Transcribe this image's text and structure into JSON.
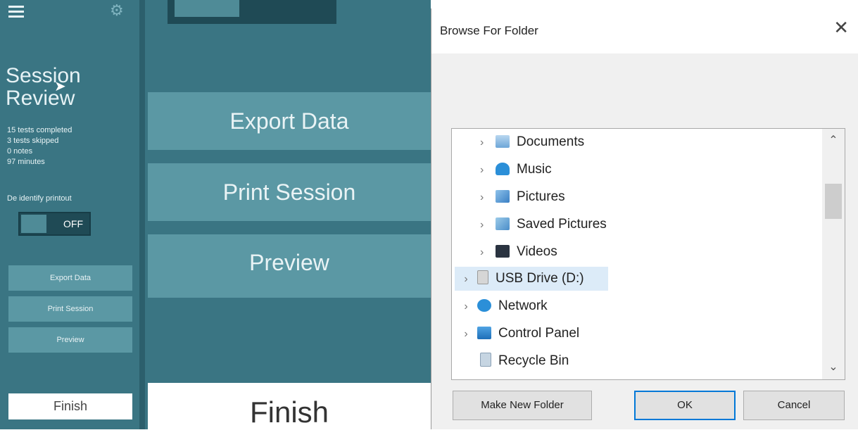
{
  "sidebar": {
    "title": "Session Review",
    "stats": [
      "15 tests completed",
      "3 tests skipped",
      "0 notes",
      "97 minutes"
    ],
    "deidentify_label": "De identify printout",
    "toggle_state": "OFF",
    "buttons": [
      "Export Data",
      "Print Session",
      "Preview"
    ],
    "finish_label": "Finish"
  },
  "main": {
    "buttons": [
      "Export Data",
      "Print Session",
      "Preview"
    ],
    "finish_label": "Finish"
  },
  "dialog": {
    "title": "Browse For Folder",
    "tree_items": [
      {
        "label": "Documents",
        "icon": "documents-icon"
      },
      {
        "label": "Music",
        "icon": "music-icon"
      },
      {
        "label": "Pictures",
        "icon": "pictures-icon"
      },
      {
        "label": "Saved Pictures",
        "icon": "saved-pictures-icon"
      },
      {
        "label": "Videos",
        "icon": "videos-icon"
      },
      {
        "label": "USB Drive (D:)",
        "icon": "usb-drive-icon",
        "selected": true
      },
      {
        "label": "Network",
        "icon": "network-icon"
      },
      {
        "label": "Control Panel",
        "icon": "control-panel-icon"
      },
      {
        "label": "Recycle Bin",
        "icon": "recycle-bin-icon"
      }
    ],
    "buttons": {
      "make_new_folder": "Make New Folder",
      "ok": "OK",
      "cancel": "Cancel"
    }
  }
}
